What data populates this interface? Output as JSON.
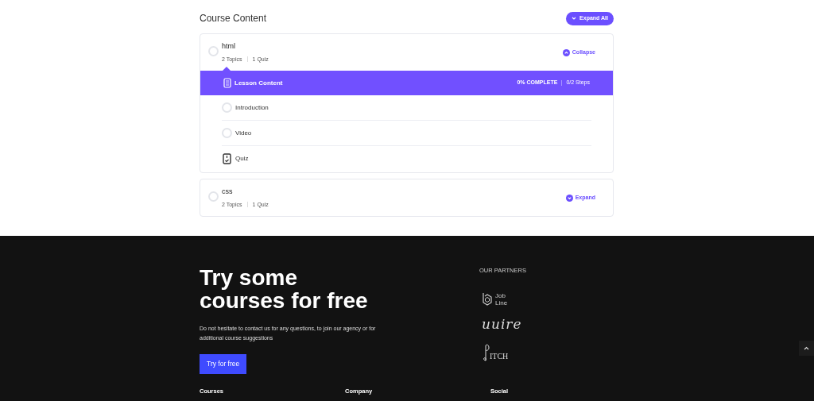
{
  "heading": "Course Content",
  "expand_all": "Expand All",
  "sections": [
    {
      "title": "html",
      "topics": "2 Topics",
      "quiz": "1 Quiz",
      "expanded": true,
      "toggle": "Collapse",
      "lesson_header": {
        "title": "Lesson Content",
        "progress": "0% COMPLETE",
        "steps": "0/2 Steps"
      },
      "items": [
        {
          "kind": "topic",
          "label": "Introduction"
        },
        {
          "kind": "topic",
          "label": "Video"
        },
        {
          "kind": "quiz",
          "label": "Quiz"
        }
      ]
    },
    {
      "title": "css",
      "topics": "2 Topics",
      "quiz": "1 Quiz",
      "expanded": false,
      "toggle": "Expand"
    }
  ],
  "footer": {
    "headline_lines": [
      "Try some",
      "courses for free"
    ],
    "description": "Do not hesitate to contact us for any questions, to join our agency or for additional course suggestions",
    "cta": "Try for free",
    "partners_title": "OUR PARTNERS",
    "partners": [
      {
        "kind": "jobline",
        "lines": [
          "Job",
          "Line"
        ]
      },
      {
        "kind": "script",
        "text": "uuire"
      },
      {
        "kind": "pitch",
        "text": "ITCH"
      }
    ],
    "columns": [
      "Courses",
      "Company",
      "Social"
    ]
  }
}
